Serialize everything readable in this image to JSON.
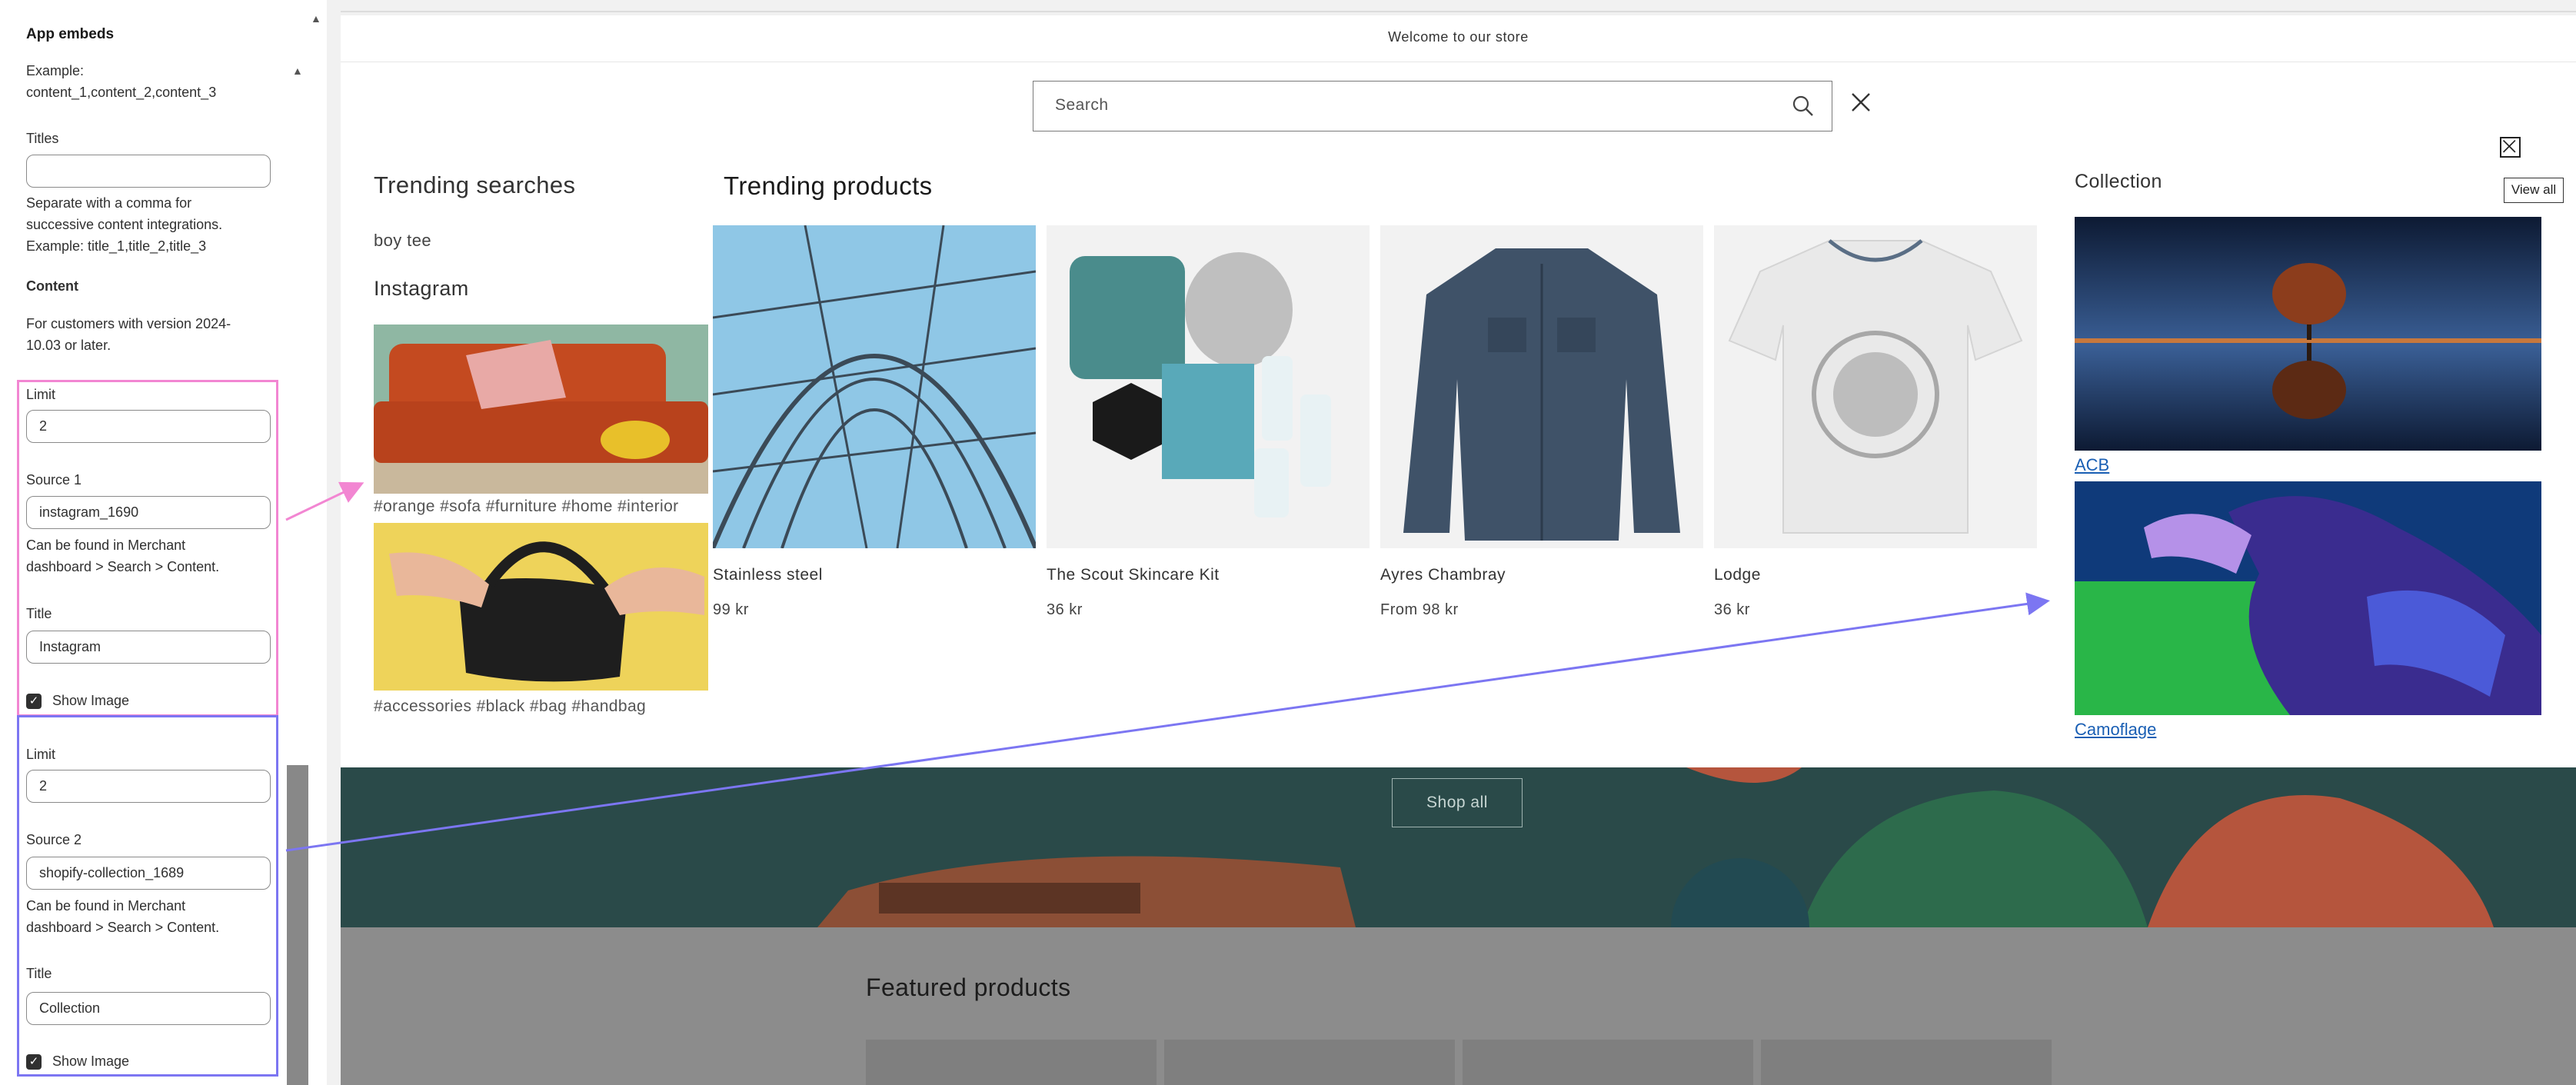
{
  "panel": {
    "header": "App embeds",
    "example_content": [
      "Example:",
      "content_1,content_2,content_3"
    ],
    "titles_label": "Titles",
    "titles_value": "",
    "titles_help": [
      "Separate with a comma for",
      "successive content integrations.",
      "Example: title_1,title_2,title_3"
    ],
    "content_heading": "Content",
    "content_help": [
      "For customers with version 2024-",
      "10.03 or later."
    ],
    "block1": {
      "limit_label": "Limit",
      "limit_value": "2",
      "source_label": "Source 1",
      "source_value": "instagram_1690",
      "source_help": [
        "Can be found in Merchant",
        "dashboard > Search > Content."
      ],
      "title_label": "Title",
      "title_value": "Instagram",
      "show_image_label": "Show Image"
    },
    "block2": {
      "limit_label": "Limit",
      "limit_value": "2",
      "source_label": "Source 2",
      "source_value": "shopify-collection_1689",
      "source_help": [
        "Can be found in Merchant",
        "dashboard > Search > Content."
      ],
      "title_label": "Title",
      "title_value": "Collection",
      "show_image_label": "Show Image"
    }
  },
  "store": {
    "welcome": "Welcome to our store",
    "search_placeholder": "Search",
    "trending_searches_title": "Trending searches",
    "trending_link": "boy tee",
    "instagram_title": "Instagram",
    "instagram_captions": [
      "#orange #sofa #furniture #home #interior",
      "#accessories #black #bag #handbag"
    ],
    "trending_products_title": "Trending products",
    "products": [
      {
        "name": "Stainless steel",
        "price": "99 kr"
      },
      {
        "name": "The Scout Skincare Kit",
        "price": "36 kr"
      },
      {
        "name": "Ayres Chambray",
        "price": "From 98 kr"
      },
      {
        "name": "Lodge",
        "price": "36 kr"
      }
    ],
    "collection_title": "Collection",
    "view_all": "View all",
    "collections": [
      "ACB",
      "Camoflage"
    ],
    "shop_all": "Shop all",
    "featured_title": "Featured products"
  },
  "colors": {
    "pink_highlight": "#f286d2",
    "blue_highlight": "#7c76f2",
    "banner": "#2a4a49",
    "sofa": "#c4481f",
    "link": "#1a5fb4"
  },
  "icons": {
    "search": "search-icon",
    "close": "close-icon",
    "checkbox": "checkmark-icon"
  }
}
